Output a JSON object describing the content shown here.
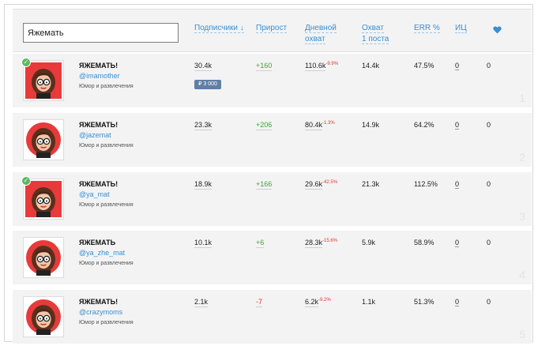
{
  "search": {
    "value": "Яжемать"
  },
  "columns": {
    "subscribers": "Подписчики ↓",
    "growth": "Прирост",
    "daily_reach_1": "Дневной",
    "daily_reach_2": "охват",
    "post_reach_1": "Охват",
    "post_reach_2": "1 поста",
    "err": "ERR %",
    "ic": "ИЦ",
    "heart_icon": "heart-icon"
  },
  "colors": {
    "accent": "#3a8ed0",
    "positive": "#3aa33a",
    "negative": "#d83434",
    "badge": "#5f7fa5"
  },
  "rows": [
    {
      "rank": "1",
      "name": "ЯЖЕМАТЬ!",
      "handle": "@imamother",
      "category": "Юмор и развлечения",
      "subscribers": "30.4k",
      "growth": "+160",
      "daily_reach": "110.6k",
      "daily_change": "-9.9%",
      "post_reach": "14.4k",
      "err": "47.5%",
      "ic": "0",
      "likes": "0",
      "verified": true,
      "price": "₽ 3 000"
    },
    {
      "rank": "2",
      "name": "ЯЖЕМАТЬ!",
      "handle": "@jazemat",
      "category": "Юмор и развлечения",
      "subscribers": "23.3k",
      "growth": "+206",
      "daily_reach": "80.4k",
      "daily_change": "-1.3%",
      "post_reach": "14.9k",
      "err": "64.2%",
      "ic": "0",
      "likes": "0",
      "verified": false
    },
    {
      "rank": "3",
      "name": "ЯЖЕМАТЬ!",
      "handle": "@ya_mat",
      "category": "Юмор и развлечения",
      "subscribers": "18.9k",
      "growth": "+166",
      "daily_reach": "29.6k",
      "daily_change": "-42.5%",
      "post_reach": "21.3k",
      "err": "112.5%",
      "ic": "0",
      "likes": "0",
      "verified": true
    },
    {
      "rank": "4",
      "name": "ЯЖЕМАТЬ",
      "handle": "@ya_zhe_mat",
      "category": "Юмор и развлечения",
      "subscribers": "10.1k",
      "growth": "+6",
      "daily_reach": "28.3k",
      "daily_change": "-15.6%",
      "post_reach": "5.9k",
      "err": "58.9%",
      "ic": "0",
      "likes": "0",
      "verified": false
    },
    {
      "rank": "5",
      "name": "ЯЖЕМАТЬ!",
      "handle": "@crazymoms",
      "category": "Юмор и развлечения",
      "subscribers": "2.1k",
      "growth": "-7",
      "daily_reach": "6.2k",
      "daily_change": "-9.2%",
      "post_reach": "1.1k",
      "err": "51.3%",
      "ic": "0",
      "likes": "0",
      "verified": false
    }
  ]
}
